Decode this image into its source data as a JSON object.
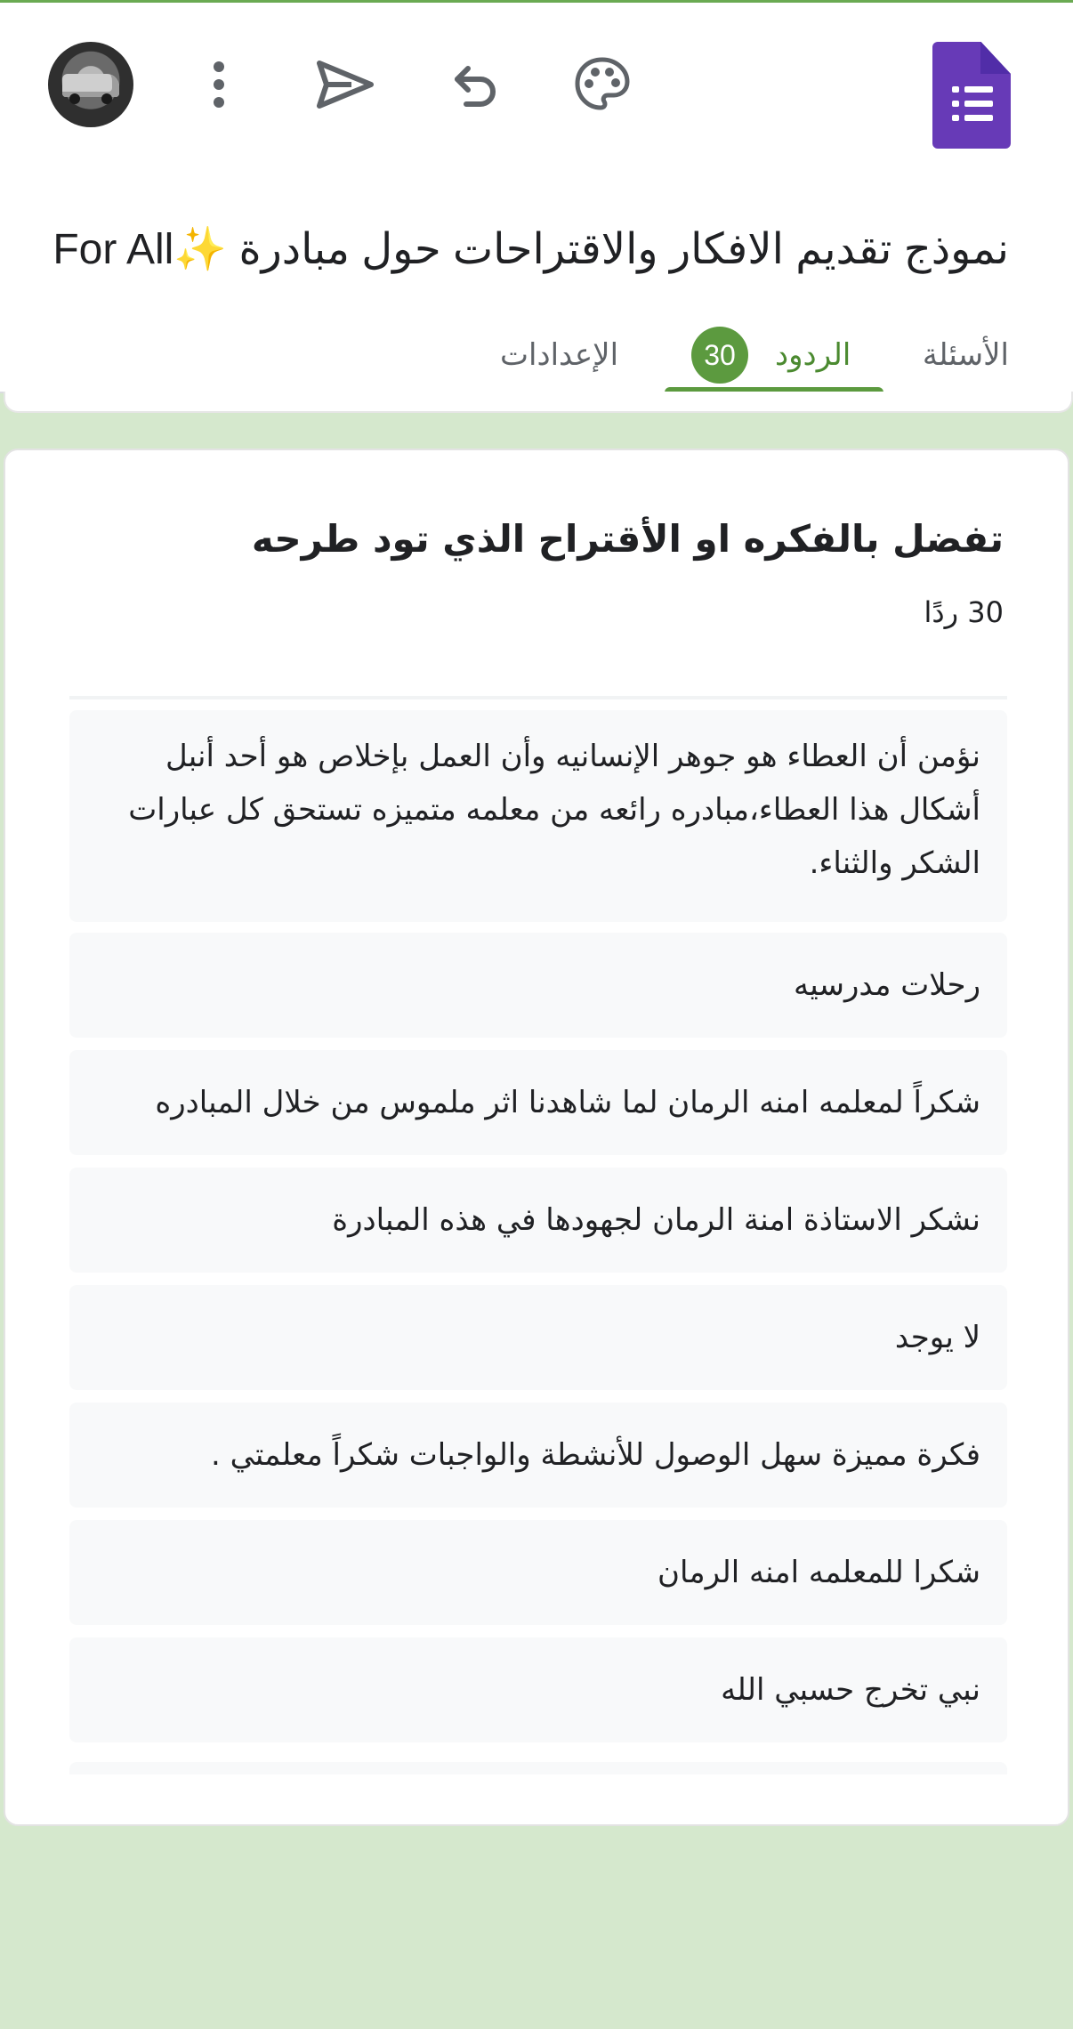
{
  "header": {
    "form_title": "نموذج تقديم الافكار والاقتراحات حول مبادرة ✨For All ",
    "icons": [
      "forms-logo-icon",
      "palette-icon",
      "undo-icon",
      "send-icon",
      "more-vert-icon",
      "avatar"
    ]
  },
  "tabs": [
    {
      "label": "الأسئلة"
    },
    {
      "label": "الردود",
      "badge": "30"
    },
    {
      "label": "الإعدادات"
    }
  ],
  "question": {
    "title": "تفضل بالفكره او الأقتراح الذي تود طرحه",
    "count": "30 ردًا",
    "responses": [
      "نؤمن أن العطاء هو جوهر الإنسانيه وأن العمل بإخلاص هو أحد أنبل أشكال هذا العطاء،مبادره رائعه من معلمه متميزه تستحق كل عبارات الشكر والثناء.",
      "رحلات مدرسيه",
      "شكراً لمعلمه امنه الرمان لما شاهدنا اثر ملموس من خلال المبادره",
      "نشكر الاستاذة امنة الرمان لجهودها في هذه المبادرة",
      "لا يوجد",
      "فكرة مميزة سهل الوصول للأنشطة والواجبات شكراً معلمتي .",
      "شكرا للمعلمه امنه الرمان",
      "نبي تخرج حسبي الله"
    ]
  },
  "colors": {
    "accent": "#5c9a3f",
    "background": "#d5e8cd",
    "forms_purple": "#673ab7"
  }
}
